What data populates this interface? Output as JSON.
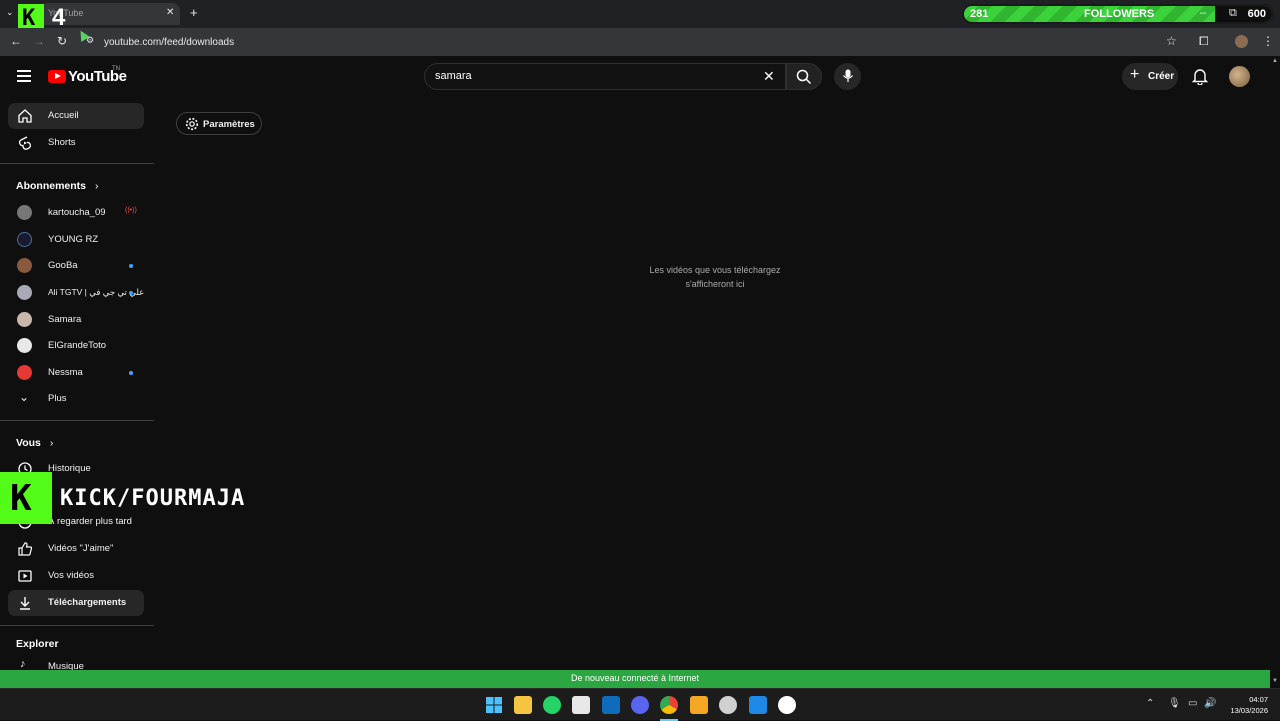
{
  "browser": {
    "tab_title": "YouTube",
    "url": "youtube.com/feed/downloads"
  },
  "overlay": {
    "kick_number": "4",
    "followers_count": "281",
    "followers_label": "FOLLOWERS",
    "followers_goal": "600",
    "followers_progress_fraction": 0.47,
    "kick_watermark": "KICK/FOURMAJA"
  },
  "header": {
    "logo_text": "YouTube",
    "country_code": "TN",
    "search_value": "samara",
    "create_label": "Créer"
  },
  "sidebar": {
    "main": [
      {
        "label": "Accueil",
        "icon": "home-icon"
      },
      {
        "label": "Shorts",
        "icon": "shorts-icon"
      }
    ],
    "subscriptions_title": "Abonnements",
    "subscriptions": [
      {
        "label": "kartoucha_09",
        "status": "live"
      },
      {
        "label": "YOUNG RZ",
        "status": ""
      },
      {
        "label": "GooBa",
        "status": "new"
      },
      {
        "label": "Ali TGTV | علي تي جي في",
        "status": "new"
      },
      {
        "label": "Samara",
        "status": ""
      },
      {
        "label": "ElGrandeToto",
        "status": ""
      },
      {
        "label": "Nessma",
        "status": "new"
      }
    ],
    "more_label": "Plus",
    "you_title": "Vous",
    "you_items": [
      {
        "label": "Historique",
        "icon": "history-icon"
      },
      {
        "label": "À regarder plus tard",
        "icon": "watch-later-icon"
      },
      {
        "label": "Vidéos \"J'aime\"",
        "icon": "like-icon"
      },
      {
        "label": "Vos vidéos",
        "icon": "your-videos-icon"
      },
      {
        "label": "Téléchargements",
        "icon": "download-icon"
      }
    ],
    "explore_title": "Explorer",
    "explore_items": [
      {
        "label": "Musique",
        "icon": "music-icon"
      }
    ]
  },
  "main": {
    "settings_label": "Paramètres",
    "empty_line1": "Les vidéos que vous téléchargez",
    "empty_line2": "s'afficheront ici"
  },
  "notification": {
    "banner_text": "De nouveau connecté à Internet"
  },
  "taskbar": {
    "time": "04:07",
    "date": "13/03/2026"
  },
  "colors": {
    "kick_green": "#53fc18",
    "youtube_red": "#ff0000",
    "banner_green": "#2ba640",
    "background": "#0f0f0f"
  }
}
